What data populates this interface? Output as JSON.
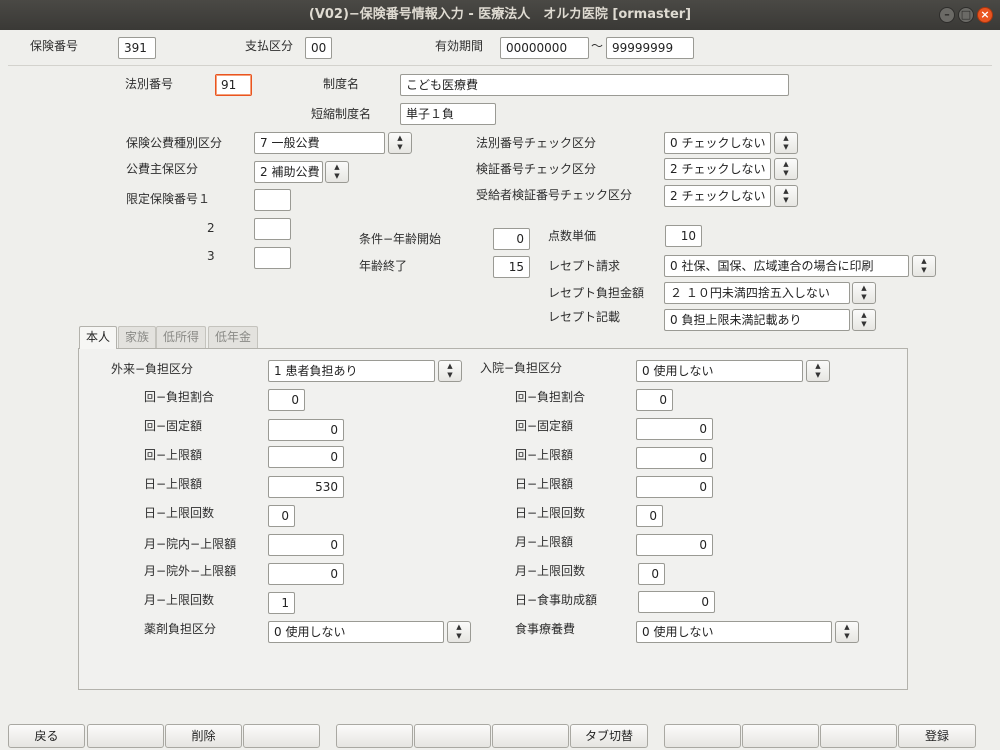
{
  "window": {
    "title": "(V02)−保険番号情報入力 - 医療法人　オルカ医院  [ormaster]"
  },
  "header": {
    "insurer_no_label": "保険番号",
    "insurer_no": "391",
    "payment_class_label": "支払区分",
    "payment_class": "00",
    "valid_period_label": "有効期間",
    "valid_from": "00000000",
    "tilde": "〜",
    "valid_to": "99999999"
  },
  "form": {
    "law_no_label": "法別番号",
    "law_no": "91",
    "system_name_label": "制度名",
    "system_name": "こども医療費",
    "short_name_label": "短縮制度名",
    "short_name": "単子１負",
    "public_type_label": "保険公費種別区分",
    "public_type": "7 一般公費",
    "public_main_label": "公費主保区分",
    "public_main": "2 補助公費",
    "limited_label": "限定保険番号１",
    "limited_2_label": "2",
    "limited_3_label": "3",
    "limited_1": "",
    "limited_2": "",
    "limited_3": "",
    "law_check_label": "法別番号チェック区分",
    "law_check": "0 チェックしない",
    "verify_check_label": "検証番号チェック区分",
    "verify_check": "2 チェックしない",
    "recipient_check_label": "受給者検証番号チェック区分",
    "recipient_check": "2 チェックしない",
    "age_start_label": "条件−年齢開始",
    "age_start": "0",
    "age_end_label": "年齢終了",
    "age_end": "15",
    "point_unit_label": "点数単価",
    "point_unit": "10",
    "receipt_claim_label": "レセプト請求",
    "receipt_claim": "0 社保、国保、広域連合の場合に印刷",
    "receipt_burden_label": "レセプト負担金額",
    "receipt_burden": "２ １０円未満四捨五入しない",
    "receipt_note_label": "レセプト記載",
    "receipt_note": "0 負担上限未満記載あり"
  },
  "tabs": [
    "本人",
    "家族",
    "低所得",
    "低年金"
  ],
  "outpatient": {
    "category_label": "外来−負担区分",
    "category": "1 患者負担あり",
    "rate_label": "回−負担割合",
    "rate": "0",
    "fixed_label": "回−固定額",
    "fixed": "0",
    "cap_label": "回−上限額",
    "cap": "0",
    "day_cap_label": "日−上限額",
    "day_cap": "530",
    "day_count_label": "日−上限回数",
    "day_count": "0",
    "month_in_label": "月−院内−上限額",
    "month_in": "0",
    "month_out_label": "月−院外−上限額",
    "month_out": "0",
    "month_count_label": "月−上限回数",
    "month_count": "1",
    "drug_label": "薬剤負担区分",
    "drug": "0 使用しない"
  },
  "inpatient": {
    "category_label": "入院−負担区分",
    "category": "0 使用しない",
    "rate_label": "回−負担割合",
    "rate": "0",
    "fixed_label": "回−固定額",
    "fixed": "0",
    "cap_label": "回−上限額",
    "cap": "0",
    "day_cap_label": "日−上限額",
    "day_cap": "0",
    "day_count_label": "日−上限回数",
    "day_count": "0",
    "month_cap_label": "月−上限額",
    "month_cap": "0",
    "month_count_label": "月−上限回数",
    "month_count": "0",
    "meal_aid_label": "日−食事助成額",
    "meal_aid": "0",
    "meal_label": "食事療養費",
    "meal": "0 使用しない"
  },
  "fkeys": [
    "戻る",
    "",
    "削除",
    "",
    "",
    "",
    "",
    "タブ切替",
    "",
    "",
    "",
    "登録"
  ]
}
